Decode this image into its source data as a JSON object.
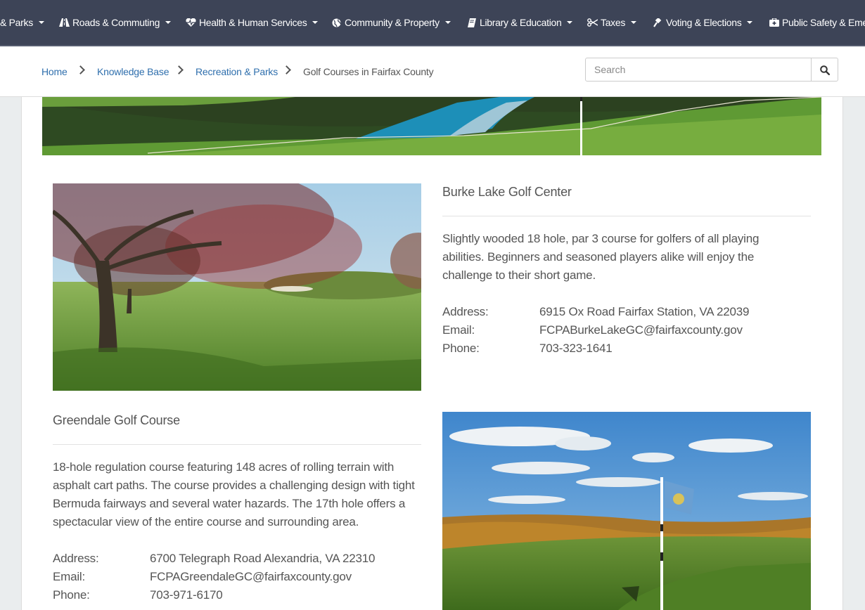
{
  "nav": {
    "items": [
      {
        "label": "& Parks",
        "icon": ""
      },
      {
        "label": "Roads & Commuting",
        "icon": "road-icon"
      },
      {
        "label": "Health & Human Services",
        "icon": "heartbeat-icon"
      },
      {
        "label": "Community & Property",
        "icon": "globe-icon"
      },
      {
        "label": "Library & Education",
        "icon": "book-icon"
      },
      {
        "label": "Taxes",
        "icon": "scissors-icon"
      },
      {
        "label": "Voting & Elections",
        "icon": "gavel-icon"
      },
      {
        "label": "Public Safety & Emer",
        "icon": "medkit-icon"
      }
    ]
  },
  "breadcrumb": {
    "home": "Home",
    "kb": "Knowledge Base",
    "section": "Recreation & Parks",
    "current": "Golf Courses in Fairfax County"
  },
  "search": {
    "placeholder": "Search"
  },
  "courses": [
    {
      "name": "Burke Lake Golf Center",
      "description": "Slightly wooded 18 hole, par 3 course for golfers of all playing abilities. Beginners and seasoned players alike will enjoy the challenge to their short game.",
      "address_label": "Address:",
      "address": "6915 Ox Road Fairfax Station, VA 22039",
      "email_label": "Email:",
      "email": "FCPABurkeLakeGC@fairfaxcounty.gov",
      "phone_label": "Phone:",
      "phone": "703-323-1641"
    },
    {
      "name": "Greendale Golf Course",
      "description": "18-hole regulation course featuring 148 acres of rolling terrain with asphalt cart paths. The course provides a challenging design with tight Bermuda fairways and several water hazards. The 17th hole offers a spectacular view of the entire course and surrounding area.",
      "address_label": "Address:",
      "address": "6700 Telegraph Road Alexandria, VA 22310",
      "email_label": "Email:",
      "email": "FCPAGreendaleGC@fairfaxcounty.gov",
      "phone_label": "Phone:",
      "phone": "703-971-6170"
    }
  ]
}
